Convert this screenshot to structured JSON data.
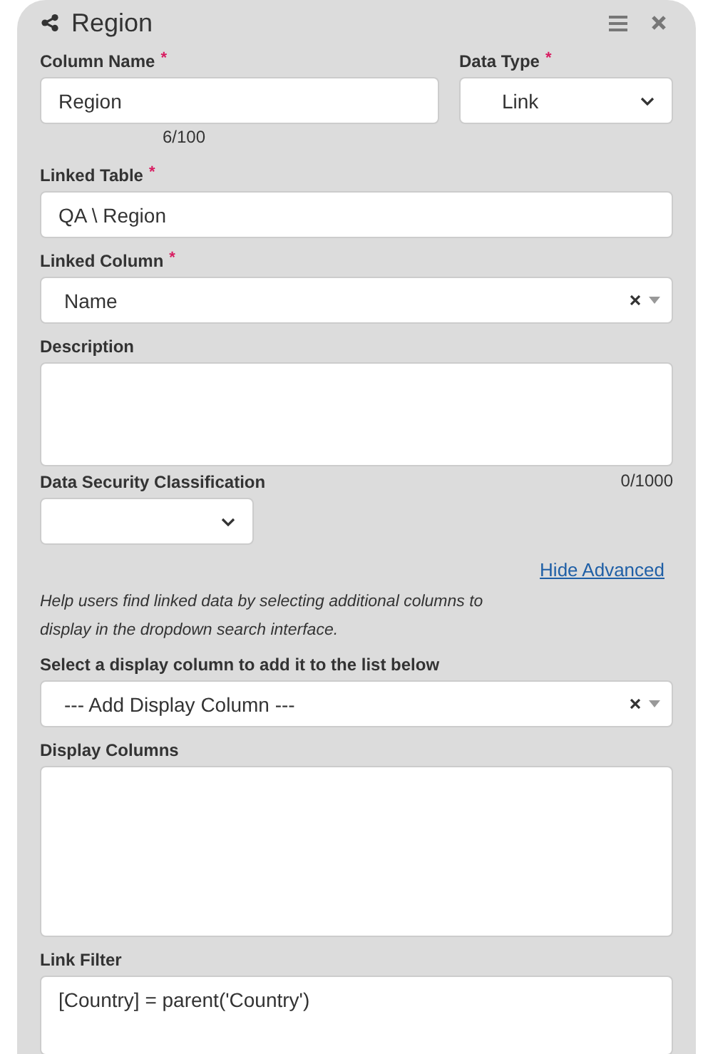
{
  "panel": {
    "title": "Region"
  },
  "fields": [
    {
      "kind": "row",
      "fields": [
        {
          "kind": "text",
          "label": "Column Name",
          "marker": "*",
          "value": "Region",
          "counter": "6/100"
        },
        {
          "kind": "select",
          "label": "Data Type",
          "marker": "*",
          "value": "Link"
        }
      ]
    },
    {
      "kind": "text",
      "label": "Linked Table",
      "marker": "*",
      "value": "QA \\ Region"
    },
    {
      "kind": "combo",
      "label": "Linked Column",
      "marker": "*",
      "value": "Name"
    },
    {
      "kind": "textarea",
      "label": "Description",
      "counter": "0/1000"
    },
    {
      "kind": "small-select",
      "label": "Data Security Classification"
    },
    {
      "kind": "link",
      "label": "Hide Advanced"
    },
    {
      "kind": "help",
      "label": "Help users find linked data by selecting additional columns to display in the dropdown search interface."
    },
    {
      "kind": "combo",
      "label": "Select a display column to add it to the list below",
      "value": "--- Add Display Column ---"
    },
    {
      "kind": "list",
      "label": "Display Columns"
    },
    {
      "kind": "text",
      "label": "Link Filter",
      "value": "[Country] = parent('Country')"
    }
  ]
}
